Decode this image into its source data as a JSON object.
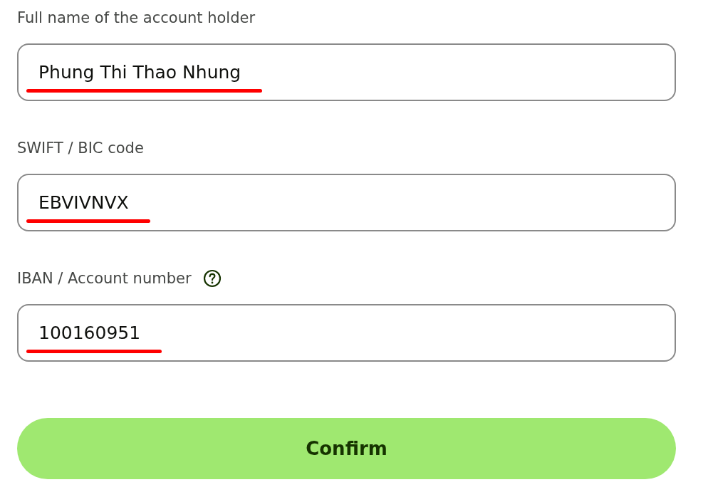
{
  "fields": [
    {
      "label": "Full name of the account holder",
      "help_icon": false,
      "value": "Phung Thi Thao Nhung",
      "underlined": true
    },
    {
      "label": "SWIFT / BIC code",
      "help_icon": false,
      "value": "EBVIVNVX",
      "underlined": true
    },
    {
      "label": "IBAN / Account number",
      "help_icon": true,
      "value": "100160951",
      "underlined": true
    }
  ],
  "button": {
    "label": "Confirm"
  }
}
